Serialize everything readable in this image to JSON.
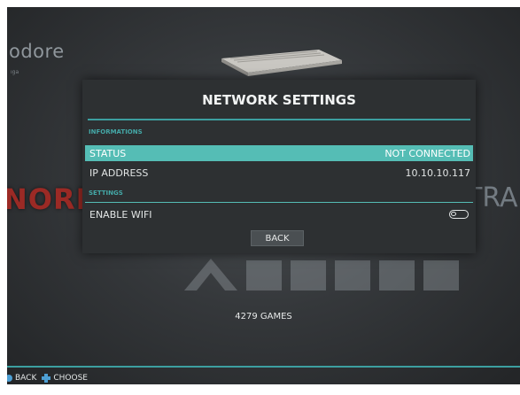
{
  "background": {
    "brand_text": "odore",
    "left_logo": "NORI",
    "right_logo": "TRAD",
    "games_count": "4279 GAMES"
  },
  "dialog": {
    "title": "NETWORK SETTINGS",
    "sections": [
      {
        "label": "INFORMATIONS",
        "rows": [
          {
            "label": "STATUS",
            "value": "NOT CONNECTED",
            "selected": true
          },
          {
            "label": "IP ADDRESS",
            "value": "10.10.10.117",
            "selected": false
          }
        ]
      },
      {
        "label": "SETTINGS",
        "rows": [
          {
            "label": "ENABLE WIFI",
            "toggle": "off"
          }
        ]
      }
    ],
    "back_label": "BACK"
  },
  "help_bar": {
    "back_label": "BACK",
    "choose_label": "CHOOSE"
  },
  "colors": {
    "accent": "#55bdb5",
    "section_label": "#44a8a7",
    "dialog_bg": "#2d3032",
    "hint_icon": "#4d9fd4"
  },
  "icons": [
    "console-image-icon",
    "b-button-icon",
    "dpad-icon",
    "toggle-switch-icon"
  ]
}
